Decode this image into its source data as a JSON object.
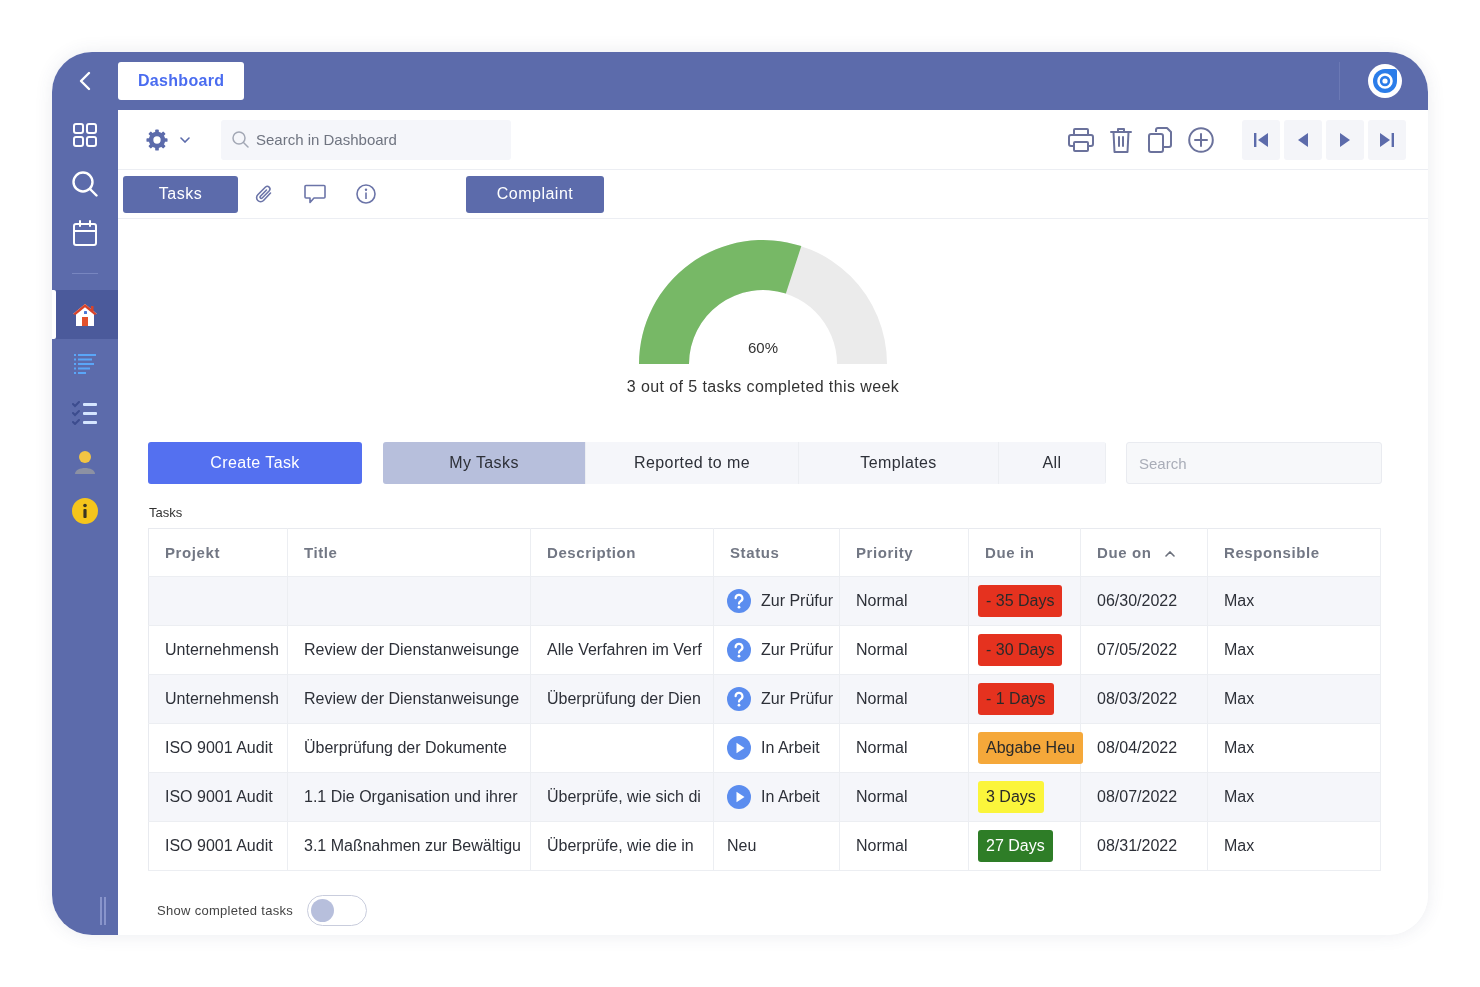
{
  "sidebar": {
    "items": [
      {
        "kind": "home",
        "selected": true
      },
      {
        "kind": "list",
        "selected": false
      },
      {
        "kind": "checklist",
        "selected": false
      },
      {
        "kind": "user",
        "selected": false
      },
      {
        "kind": "info",
        "selected": false
      }
    ]
  },
  "tabs": [
    {
      "label": "Dashboard",
      "selected": true
    }
  ],
  "toolbar": {
    "search": {
      "placeholder": "Search in Dashboard"
    }
  },
  "section_buttons": [
    "Tasks",
    "Complaint"
  ],
  "gauge": {
    "level": 0.6,
    "reading": "60%",
    "caption": "3 out of 5 tasks completed this week"
  },
  "create_button": "Create Task",
  "filter_tabs": [
    {
      "label": "My Tasks",
      "selected": true
    },
    {
      "label": "Reported to me",
      "selected": false
    },
    {
      "label": "Templates",
      "selected": false
    },
    {
      "label": "All",
      "selected": false
    }
  ],
  "filter_search": {
    "placeholder": "Search"
  },
  "table": {
    "title": "Tasks",
    "columns": [
      {
        "label": "Projekt",
        "sorted": false
      },
      {
        "label": "Title",
        "sorted": false
      },
      {
        "label": "Description",
        "sorted": false
      },
      {
        "label": "Status",
        "sorted": false
      },
      {
        "label": "Priority",
        "sorted": false
      },
      {
        "label": "Due in",
        "sorted": false
      },
      {
        "label": "Due on",
        "sorted": true
      },
      {
        "label": "Responsible",
        "sorted": false
      }
    ],
    "rows": [
      {
        "status": {
          "kind": "review",
          "text": "Zur Prüfur"
        },
        "priority": "Normal",
        "due_in": {
          "text": "- 35 Days",
          "color": "#e5321f"
        },
        "due_on": "06/30/2022",
        "responsible": "Max"
      },
      {
        "projekt": "Unternehmensh",
        "title": "Review der Dienstanweisunge",
        "description": "Alle Verfahren im Verf",
        "status": {
          "kind": "review",
          "text": "Zur Prüfur"
        },
        "priority": "Normal",
        "due_in": {
          "text": "- 30 Days",
          "color": "#e5321f"
        },
        "due_on": "07/05/2022",
        "responsible": "Max"
      },
      {
        "projekt": "Unternehmensh",
        "title": "Review der Dienstanweisunge",
        "description": "Überprüfung der Dien",
        "status": {
          "kind": "review",
          "text": "Zur Prüfur"
        },
        "priority": "Normal",
        "due_in": {
          "text": "- 1 Days",
          "color": "#e5321f"
        },
        "due_on": "08/03/2022",
        "responsible": "Max"
      },
      {
        "projekt": "ISO 9001 Audit",
        "title": "Überprüfung der Dokumente",
        "status": {
          "kind": "in_progress",
          "text": "In Arbeit"
        },
        "priority": "Normal",
        "due_in": {
          "text": "Abgabe Heu",
          "color": "#f5a83a"
        },
        "due_on": "08/04/2022",
        "responsible": "Max"
      },
      {
        "projekt": "ISO 9001 Audit",
        "title": "1.1 Die Organisation und ihrer",
        "description": "Überprüfe, wie sich di",
        "status": {
          "kind": "in_progress",
          "text": "In Arbeit"
        },
        "priority": "Normal",
        "due_in": {
          "text": "3 Days",
          "color": "#fbf53b"
        },
        "due_on": "08/07/2022",
        "responsible": "Max"
      },
      {
        "projekt": "ISO 9001 Audit",
        "title": "3.1 Maßnahmen zur Bewältigu",
        "description": "Überprüfe, wie die in",
        "status": {
          "kind": "new",
          "text": "Neu"
        },
        "priority": "Normal",
        "due_in": {
          "text": "27 Days",
          "color": "#2e7d27"
        },
        "due_on": "08/31/2022",
        "responsible": "Max"
      }
    ]
  },
  "show_completed": {
    "label": "Show completed tasks",
    "on": false
  }
}
